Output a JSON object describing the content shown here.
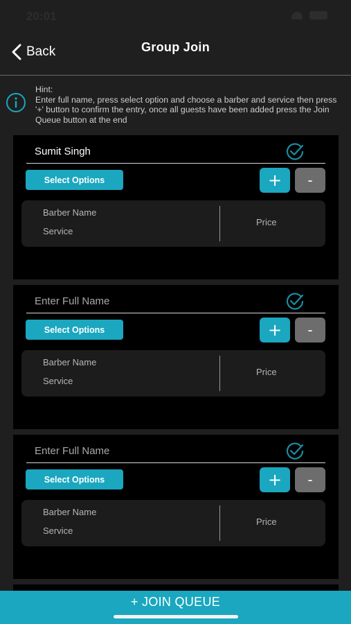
{
  "status_bar": {
    "time": "20:01"
  },
  "nav": {
    "back_label": "Back",
    "title": "Group Join"
  },
  "hint": {
    "title": "Hint:",
    "text": "Enter full name, press select option and choose a barber and service then press '+' button to confirm the entry, once all guests have been added press the Join Queue button at the end"
  },
  "guests": [
    {
      "name": "Sumit Singh",
      "placeholder": "Enter Full Name",
      "select_label": "Select Options",
      "plus": "+",
      "minus": "-",
      "barber_label": "Barber Name",
      "service_label": "Service",
      "price_label": "Price"
    },
    {
      "name": "",
      "placeholder": "Enter Full Name",
      "select_label": "Select Options",
      "plus": "+",
      "minus": "-",
      "barber_label": "Barber Name",
      "service_label": "Service",
      "price_label": "Price"
    },
    {
      "name": "",
      "placeholder": "Enter Full Name",
      "select_label": "Select Options",
      "plus": "+",
      "minus": "-",
      "barber_label": "Barber Name",
      "service_label": "Service",
      "price_label": "Price"
    }
  ],
  "footer": {
    "join_label": "+ JOIN QUEUE"
  },
  "colors": {
    "accent": "#1aa7bf",
    "minus_button": "#6d6d6d",
    "panel": "#1f1f1f",
    "card": "#000000",
    "check_icon": "#1a8ea2"
  },
  "icons": {
    "back": "chevron-left-icon",
    "info": "info-circle-icon",
    "confirm": "check-circle-icon"
  }
}
